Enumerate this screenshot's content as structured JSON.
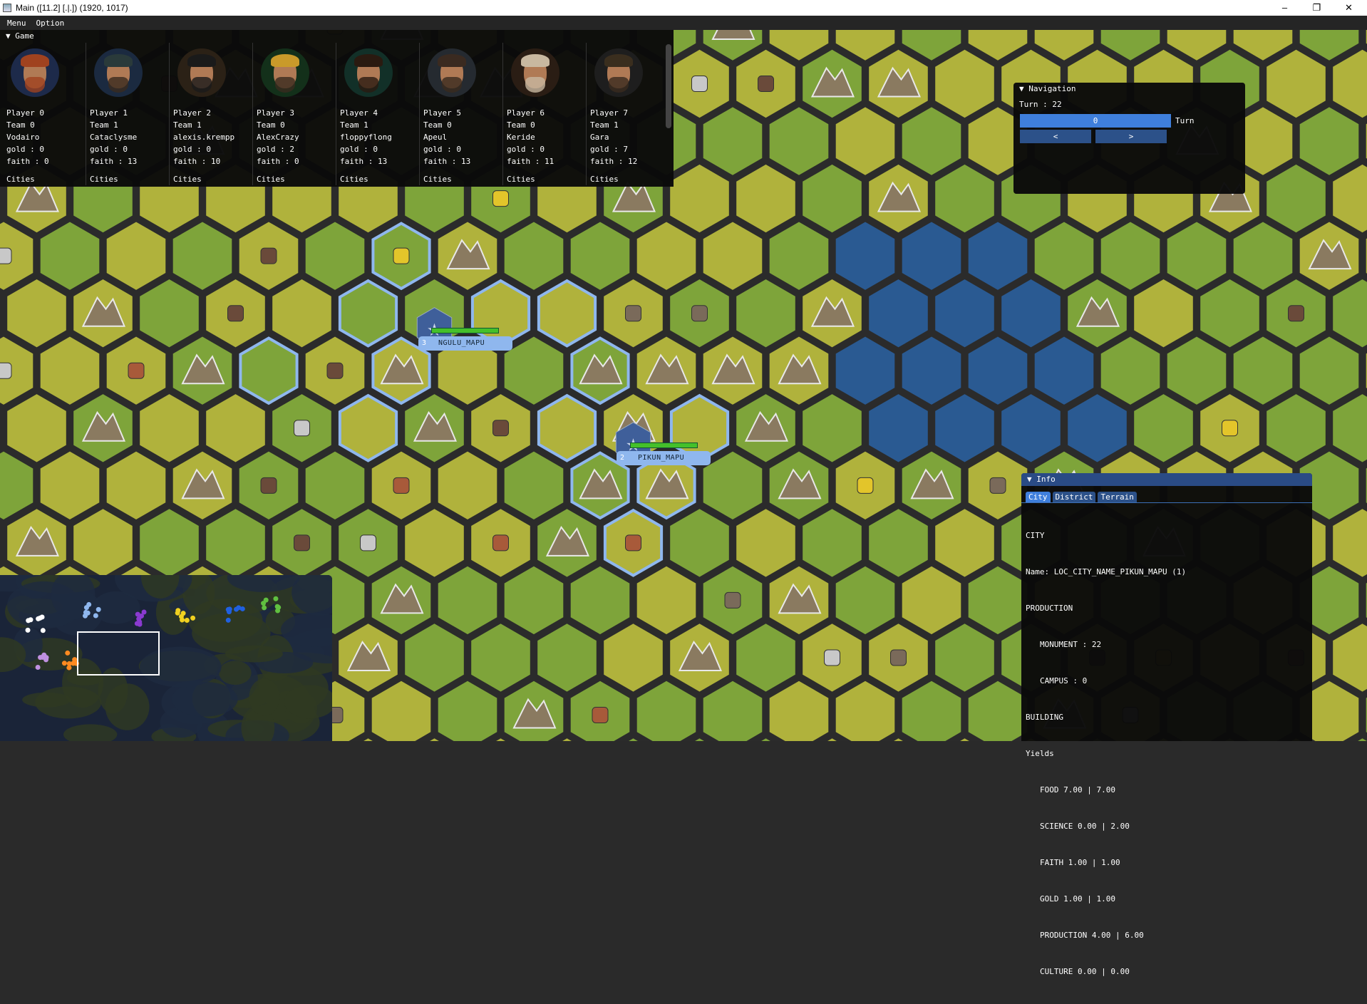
{
  "window": {
    "title": "Main ([11.2] [.|.]) (1920, 1017)",
    "minimize": "–",
    "maximize": "❐",
    "close": "✕"
  },
  "menubar": {
    "items": [
      "Menu",
      "Option"
    ]
  },
  "game_panel": {
    "title": "▼ Game",
    "players": [
      {
        "name": "Player 0",
        "team": "Team 0",
        "user": "Vodairo",
        "gold": "gold : 0",
        "faith": "faith : 0",
        "cities": "Cities",
        "hair": "#a0421f",
        "bg": "#1d2a4a"
      },
      {
        "name": "Player 1",
        "team": "Team 1",
        "user": "Cataclysme",
        "gold": "gold : 0",
        "faith": "faith : 13",
        "cities": "Cities",
        "hair": "#2a3a3a",
        "bg": "#1b2a40"
      },
      {
        "name": "Player 2",
        "team": "Team 1",
        "user": "alexis.krempp",
        "gold": "gold : 0",
        "faith": "faith : 10",
        "cities": "Cities",
        "hair": "#1a1a1a",
        "bg": "#2b2116"
      },
      {
        "name": "Player 3",
        "team": "Team 0",
        "user": "AlexCrazy",
        "gold": "gold : 2",
        "faith": "faith : 0",
        "cities": "Cities",
        "hair": "#c99a2a",
        "bg": "#13301a"
      },
      {
        "name": "Player 4",
        "team": "Team 1",
        "user": "floppyflong",
        "gold": "gold : 0",
        "faith": "faith : 13",
        "cities": "Cities",
        "hair": "#2a1a10",
        "bg": "#123028"
      },
      {
        "name": "Player 5",
        "team": "Team 0",
        "user": "Apeul",
        "gold": "gold : 0",
        "faith": "faith : 13",
        "cities": "Cities",
        "hair": "#3a2a20",
        "bg": "#252a30"
      },
      {
        "name": "Player 6",
        "team": "Team 0",
        "user": "Keride",
        "gold": "gold : 0",
        "faith": "faith : 11",
        "cities": "Cities",
        "hair": "#c8b8a0",
        "bg": "#2a1d14"
      },
      {
        "name": "Player 7",
        "team": "Team 1",
        "user": "Gara",
        "gold": "gold : 7",
        "faith": "faith : 12",
        "cities": "Cities",
        "hair": "#3a2e1e",
        "bg": "#1e1e1e"
      }
    ]
  },
  "navigation": {
    "title": "▼ Navigation",
    "turn": "Turn : 22",
    "slider_value": "0",
    "slider_label": "Turn",
    "prev": "<",
    "next": ">"
  },
  "info": {
    "title": "▼ Info",
    "tabs": [
      "City",
      "District",
      "Terrain"
    ],
    "active_tab": "City",
    "lines": {
      "city": "CITY",
      "name": "Name: LOC_CITY_NAME_PIKUN_MAPU (1)",
      "production": "PRODUCTION",
      "monument": "MONUMENT : 22",
      "campus": "CAMPUS : 0",
      "building": "BUILDING",
      "yields": "Yields",
      "food": "FOOD 7.00 | 7.00",
      "science": "SCIENCE 0.00 | 2.00",
      "faith": "FAITH 1.00 | 1.00",
      "gold": "GOLD 1.00 | 1.00",
      "prod": "PRODUCTION 4.00 | 6.00",
      "culture": "CULTURE 0.00 | 0.00"
    }
  },
  "map": {
    "cities": [
      {
        "number": "3",
        "name": "NGULU_MAPU"
      },
      {
        "number": "2",
        "name": "PIKUN_MAPU"
      }
    ],
    "colors": {
      "plains": "#b0b23c",
      "grassland": "#7ea43a",
      "water": "#2a5a92",
      "mountain": "#8a7a60",
      "border": "#1a22b0",
      "city_border": "#8fb7ee"
    }
  }
}
